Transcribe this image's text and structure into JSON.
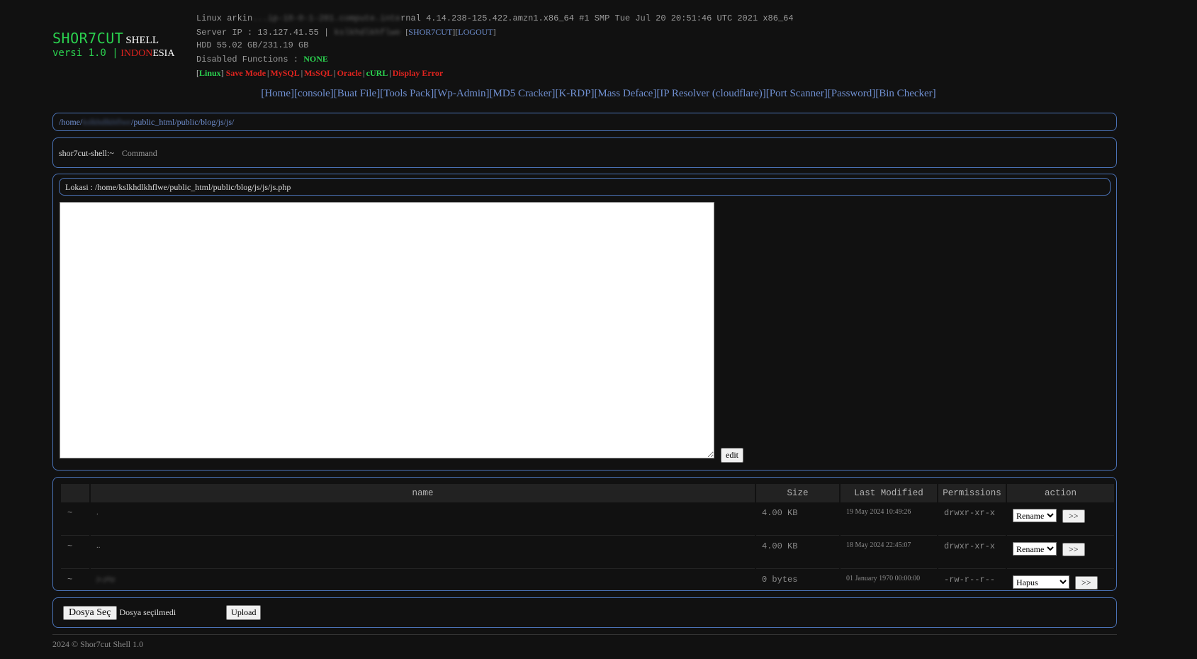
{
  "logo": {
    "brand": "SHOR7CUT",
    "shell": "SHELL",
    "version": "versi 1.0 |",
    "indo": "INDON",
    "nesia": "ESIA"
  },
  "sysinfo": {
    "uname_prefix": "Linux arkin",
    "uname_blurred": "...ip-10-0-1-201.compute.inte",
    "uname_suffix": "rnal 4.14.238-125.422.amzn1.x86_64 #1 SMP Tue Jul 20 20:51:46 UTC 2021 x86_64",
    "server_ip_label": "Server IP : 13.127.41.55 |",
    "server_ip_blurred": "kslkhdlkhflwe",
    "shor7cut_link": "SHOR7CUT",
    "logout_link": "LOGOUT",
    "hdd": "HDD 55.02 GB/231.19 GB",
    "disabled_label": "Disabled Functions :",
    "disabled_value": "NONE",
    "features": {
      "linux": "Linux",
      "save_mode": "Save Mode",
      "mysql": "MySQL",
      "mssql": "MsSQL",
      "oracle": "Oracle",
      "curl": "cURL",
      "display_error": "Display Error"
    }
  },
  "nav": [
    "[Home]",
    "[console]",
    "[Buat File]",
    "[Tools Pack]",
    "[Wp-Admin]",
    "[MD5 Cracker]",
    "[K-RDP]",
    "[Mass Deface]",
    "[IP Resolver (cloudflare)]",
    "[Port Scanner]",
    "[Password]",
    "[Bin Checker]"
  ],
  "path": {
    "prefix": "/home/",
    "blurred": "kslkhdlkhflwe",
    "suffix": "/public_html/public/blog/js/js/"
  },
  "console": {
    "prompt": "shor7cut-shell:~",
    "placeholder": "Command"
  },
  "editor": {
    "lokasi": "Lokasi : /home/kslkhdlkhflwe/public_html/public/blog/js/js/js.php",
    "content": "",
    "edit_label": "edit"
  },
  "table": {
    "headers": [
      "",
      "name",
      "Size",
      "Last Modified",
      "Permissions",
      "action"
    ],
    "rows": [
      {
        "tilde": "~",
        "name": ".",
        "size": "4.00 KB",
        "modified": "19 May 2024 10:49:26",
        "perms": "drwxr-xr-x",
        "action": "Rename",
        "go": ">>"
      },
      {
        "tilde": "~",
        "name": "..",
        "size": "4.00 KB",
        "modified": "18 May 2024 22:45:07",
        "perms": "drwxr-xr-x",
        "action": "Rename",
        "go": ">>"
      },
      {
        "tilde": "~",
        "name": "js.php",
        "size": "0 bytes",
        "modified": "01 January 1970 00:00:00",
        "perms": "-rw-r--r--",
        "action": "Hapus",
        "go": ">>"
      }
    ]
  },
  "upload": {
    "choose_label": "Dosya Seç",
    "no_file": "Dosya seçilmedi",
    "upload_label": "Upload"
  },
  "footer": "2024 © Shor7cut Shell 1.0"
}
